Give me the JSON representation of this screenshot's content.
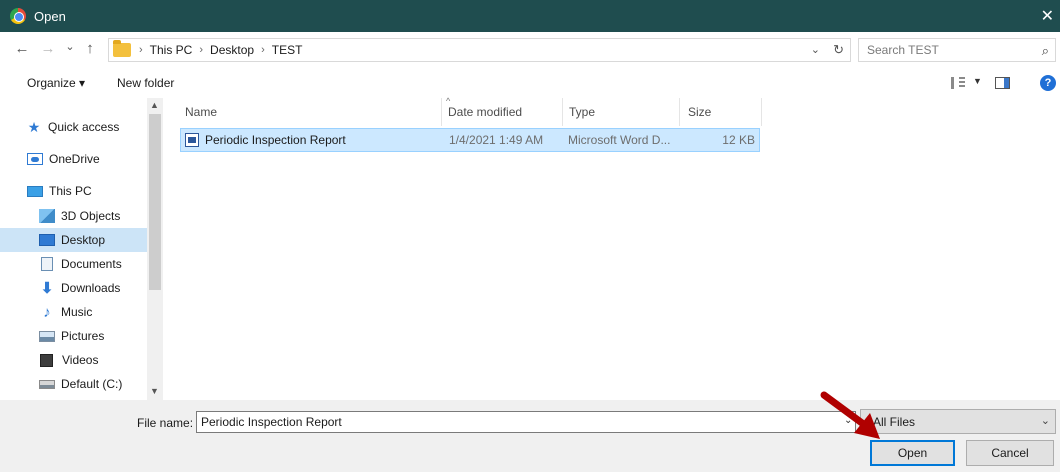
{
  "window": {
    "title": "Open",
    "close_glyph": "✕"
  },
  "nav": {
    "back": "←",
    "forward": "→",
    "recent": "⌄",
    "up": "↑"
  },
  "address": {
    "crumbs": [
      "This PC",
      "Desktop",
      "TEST"
    ],
    "separator": "›",
    "dropdown_glyph": "⌄",
    "refresh_glyph": "↻"
  },
  "search": {
    "placeholder": "Search TEST",
    "icon": "⌕"
  },
  "toolbar": {
    "organize": "Organize ▾",
    "new_folder": "New folder",
    "view_dropdown": "▼",
    "help": "?"
  },
  "sidebar": {
    "items": [
      {
        "label": "Quick access",
        "icon": "star-icon"
      },
      {
        "label": "OneDrive",
        "icon": "onedrive-icon"
      },
      {
        "label": "This PC",
        "icon": "computer-icon"
      },
      {
        "label": "3D Objects",
        "icon": "cube-icon"
      },
      {
        "label": "Desktop",
        "icon": "desktop-icon",
        "selected": true
      },
      {
        "label": "Documents",
        "icon": "document-icon"
      },
      {
        "label": "Downloads",
        "icon": "download-icon"
      },
      {
        "label": "Music",
        "icon": "music-icon"
      },
      {
        "label": "Pictures",
        "icon": "pictures-icon"
      },
      {
        "label": "Videos",
        "icon": "video-icon"
      },
      {
        "label": "Default (C:)",
        "icon": "drive-icon"
      }
    ],
    "scroll_up": "▲",
    "scroll_down": "▼"
  },
  "columns": [
    "Name",
    "Date modified",
    "Type",
    "Size"
  ],
  "sort_caret": "^",
  "files": [
    {
      "name": "Periodic Inspection Report",
      "date": "1/4/2021 1:49 AM",
      "type": "Microsoft Word D...",
      "size": "12 KB"
    }
  ],
  "bottom": {
    "file_name_label": "File name:",
    "file_name_value": "Periodic Inspection Report",
    "file_name_dropdown": "⌄",
    "filter": "All Files",
    "filter_dropdown": "⌄",
    "open_label": "Open",
    "cancel_label": "Cancel"
  },
  "colors": {
    "titlebar": "#1f4d4f",
    "selection": "#cce8ff",
    "arrow": "#b00000",
    "accent": "#0078d7"
  }
}
